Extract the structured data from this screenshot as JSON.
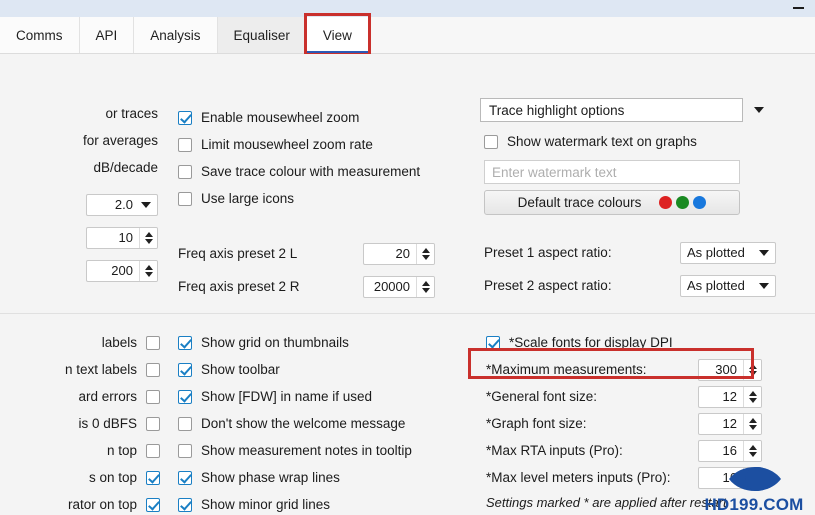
{
  "window": {
    "minimize_label": "—"
  },
  "tabs": [
    {
      "label": "Comms",
      "state": "normal"
    },
    {
      "label": "API",
      "state": "normal"
    },
    {
      "label": "Analysis",
      "state": "normal"
    },
    {
      "label": "Equaliser",
      "state": "hover"
    },
    {
      "label": "View",
      "state": "active"
    }
  ],
  "top_section": {
    "left_column": {
      "clipped_labels": [
        "or traces",
        "for averages",
        "dB/decade"
      ],
      "fields": [
        {
          "type": "combo",
          "value": "2.0"
        },
        {
          "type": "spin",
          "value": "10"
        },
        {
          "type": "spin",
          "value": "200"
        }
      ]
    },
    "middle_column": {
      "checkboxes": [
        {
          "label": "Enable mousewheel zoom",
          "checked": true
        },
        {
          "label": "Limit mousewheel zoom rate",
          "checked": false
        },
        {
          "label": "Save trace colour with measurement",
          "checked": false
        },
        {
          "label": "Use large icons",
          "checked": false
        }
      ],
      "fields": [
        {
          "label": "Freq axis preset 2 L",
          "value": "20"
        },
        {
          "label": "Freq axis preset 2 R",
          "value": "20000"
        }
      ]
    },
    "right_column": {
      "trace_highlight_dropdown": "Trace highlight options",
      "watermark_checkbox": {
        "label": "Show watermark text on graphs",
        "checked": false
      },
      "watermark_input": {
        "value": "",
        "placeholder": "Enter watermark text"
      },
      "default_trace_colours": {
        "label": "Default trace colours",
        "swatches": [
          "#dd2222",
          "#1a8a22",
          "#1878dd"
        ]
      },
      "aspect_fields": [
        {
          "label": "Preset 1 aspect ratio:",
          "value": "As plotted"
        },
        {
          "label": "Preset 2 aspect ratio:",
          "value": "As plotted"
        }
      ]
    }
  },
  "bottom_section": {
    "left_column": {
      "clipped_rows": [
        {
          "label": " labels",
          "checked": false
        },
        {
          "label": "n text labels",
          "checked": false
        },
        {
          "label": "ard errors",
          "checked": false
        },
        {
          "label": " is 0 dBFS",
          "checked": false
        },
        {
          "label": "n top",
          "checked": false
        },
        {
          "label": "s on top",
          "checked": true
        },
        {
          "label": "rator on top",
          "checked": true
        }
      ]
    },
    "middle_column": {
      "checkboxes": [
        {
          "label": "Show grid on thumbnails",
          "checked": true
        },
        {
          "label": "Show toolbar",
          "checked": true
        },
        {
          "label": "Show [FDW] in name if used",
          "checked": true
        },
        {
          "label": "Don't show the welcome message",
          "checked": false
        },
        {
          "label": "Show measurement notes in tooltip",
          "checked": false
        },
        {
          "label": "Show phase wrap lines",
          "checked": true
        },
        {
          "label": "Show minor grid lines",
          "checked": true
        }
      ]
    },
    "right_column": {
      "scale_fonts": {
        "label": "*Scale fonts for display DPI",
        "checked": true
      },
      "fields": [
        {
          "label": "*Maximum measurements:",
          "value": "300",
          "highlighted": true
        },
        {
          "label": "*General font size:",
          "value": "12",
          "highlighted": false
        },
        {
          "label": "*Graph font size:",
          "value": "12",
          "highlighted": false
        },
        {
          "label": "*Max RTA inputs (Pro):",
          "value": "16",
          "highlighted": false
        },
        {
          "label": "*Max level meters inputs (Pro):",
          "value": "16",
          "highlighted": false
        }
      ],
      "footnote": "Settings marked * are applied after restart"
    }
  },
  "watermark": {
    "text": "HD199.COM",
    "logo": "eye-icon",
    "color": "#1c4fa1"
  },
  "annotations": {
    "accent_red": "#c9302c",
    "accent_blue": "#2b59b5"
  }
}
